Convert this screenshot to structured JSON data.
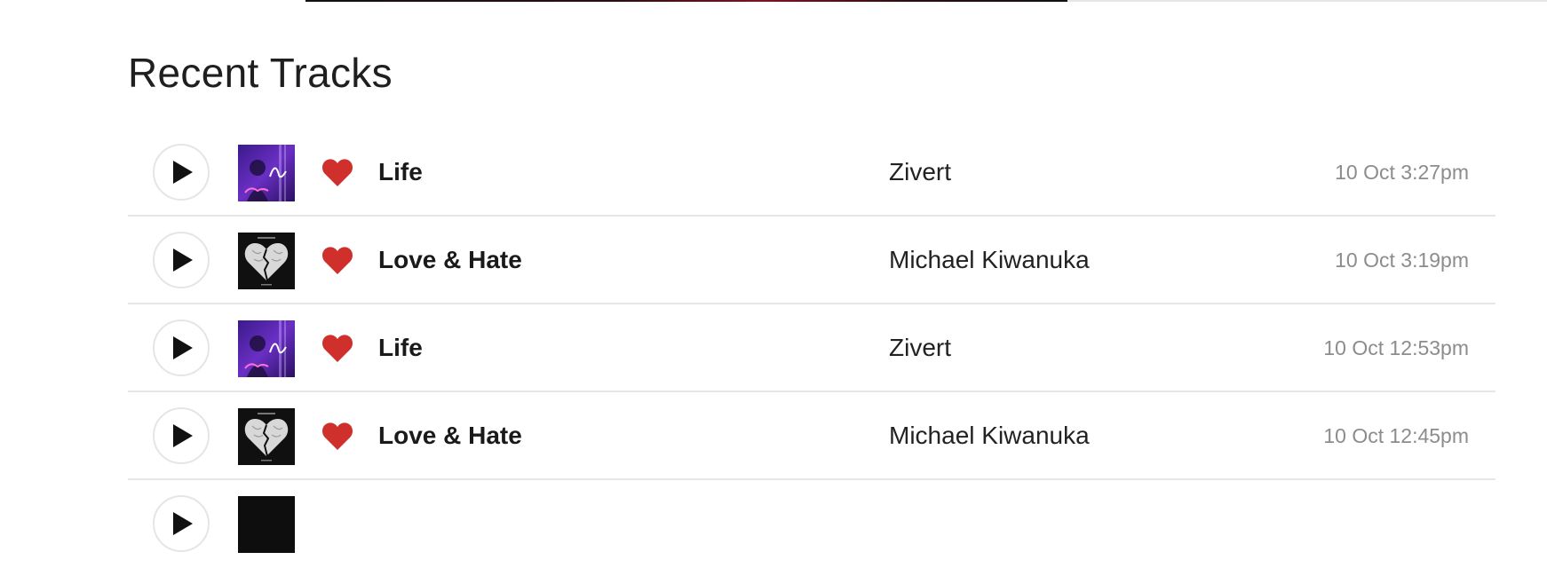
{
  "section": {
    "title": "Recent Tracks"
  },
  "progress": {
    "fraction": 0.614
  },
  "colors": {
    "like": "#d0302c",
    "text": "#1a1a1a",
    "muted": "#8c8c8c",
    "divider": "#e6e6e6"
  },
  "icons": {
    "play": "play-icon",
    "like": "heart-icon"
  },
  "tracks": [
    {
      "title": "Life",
      "artist": "Zivert",
      "played_at": "10 Oct 3:27pm",
      "cover": "life-cover",
      "liked": true
    },
    {
      "title": "Love & Hate",
      "artist": "Michael Kiwanuka",
      "played_at": "10 Oct 3:19pm",
      "cover": "love-hate-cover",
      "liked": true
    },
    {
      "title": "Life",
      "artist": "Zivert",
      "played_at": "10 Oct 12:53pm",
      "cover": "life-cover",
      "liked": true
    },
    {
      "title": "Love & Hate",
      "artist": "Michael Kiwanuka",
      "played_at": "10 Oct 12:45pm",
      "cover": "love-hate-cover",
      "liked": true
    }
  ]
}
